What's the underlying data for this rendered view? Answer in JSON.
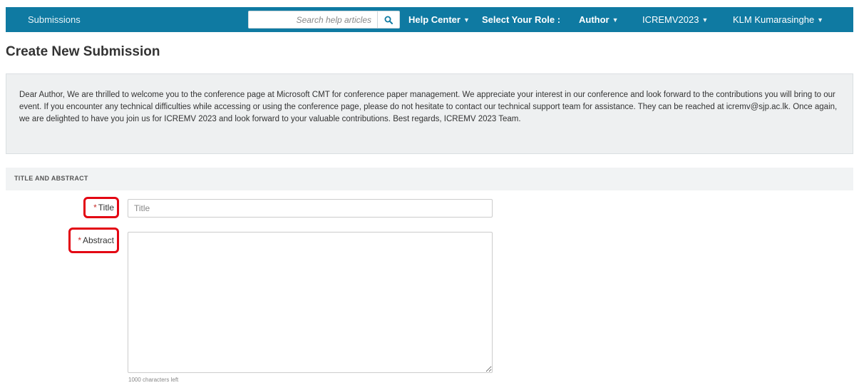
{
  "nav": {
    "submissions": "Submissions",
    "search_placeholder": "Search help articles",
    "search_icon": "magnifier-icon",
    "help_center": "Help Center",
    "select_role_label": "Select Your Role :",
    "role": "Author",
    "conference": "ICREMV2023",
    "user": "KLM Kumarasinghe",
    "caret_icon": "caret-down-icon",
    "bar_color": "#0f7aa2"
  },
  "page": {
    "title": "Create New Submission",
    "welcome_message": "Dear Author, We are thrilled to welcome you to the conference page at Microsoft CMT for conference paper management. We appreciate your interest in our conference and look forward to the contributions you will bring to our event. If you encounter any technical difficulties while accessing or using the conference page, please do not hesitate to contact our technical support team for assistance. They can be reached at icremv@sjp.ac.lk. Once again, we are delighted to have you join us for ICREMV 2023 and look forward to your valuable contributions. Best regards, ICREMV 2023 Team."
  },
  "section": {
    "heading": "TITLE AND ABSTRACT"
  },
  "form": {
    "required_mark": "*",
    "title_label": "Title",
    "title_placeholder": "Title",
    "title_value": "",
    "abstract_label": "Abstract",
    "abstract_value": "",
    "chars_left": "1000 characters left",
    "highlight_color": "#e30613"
  }
}
